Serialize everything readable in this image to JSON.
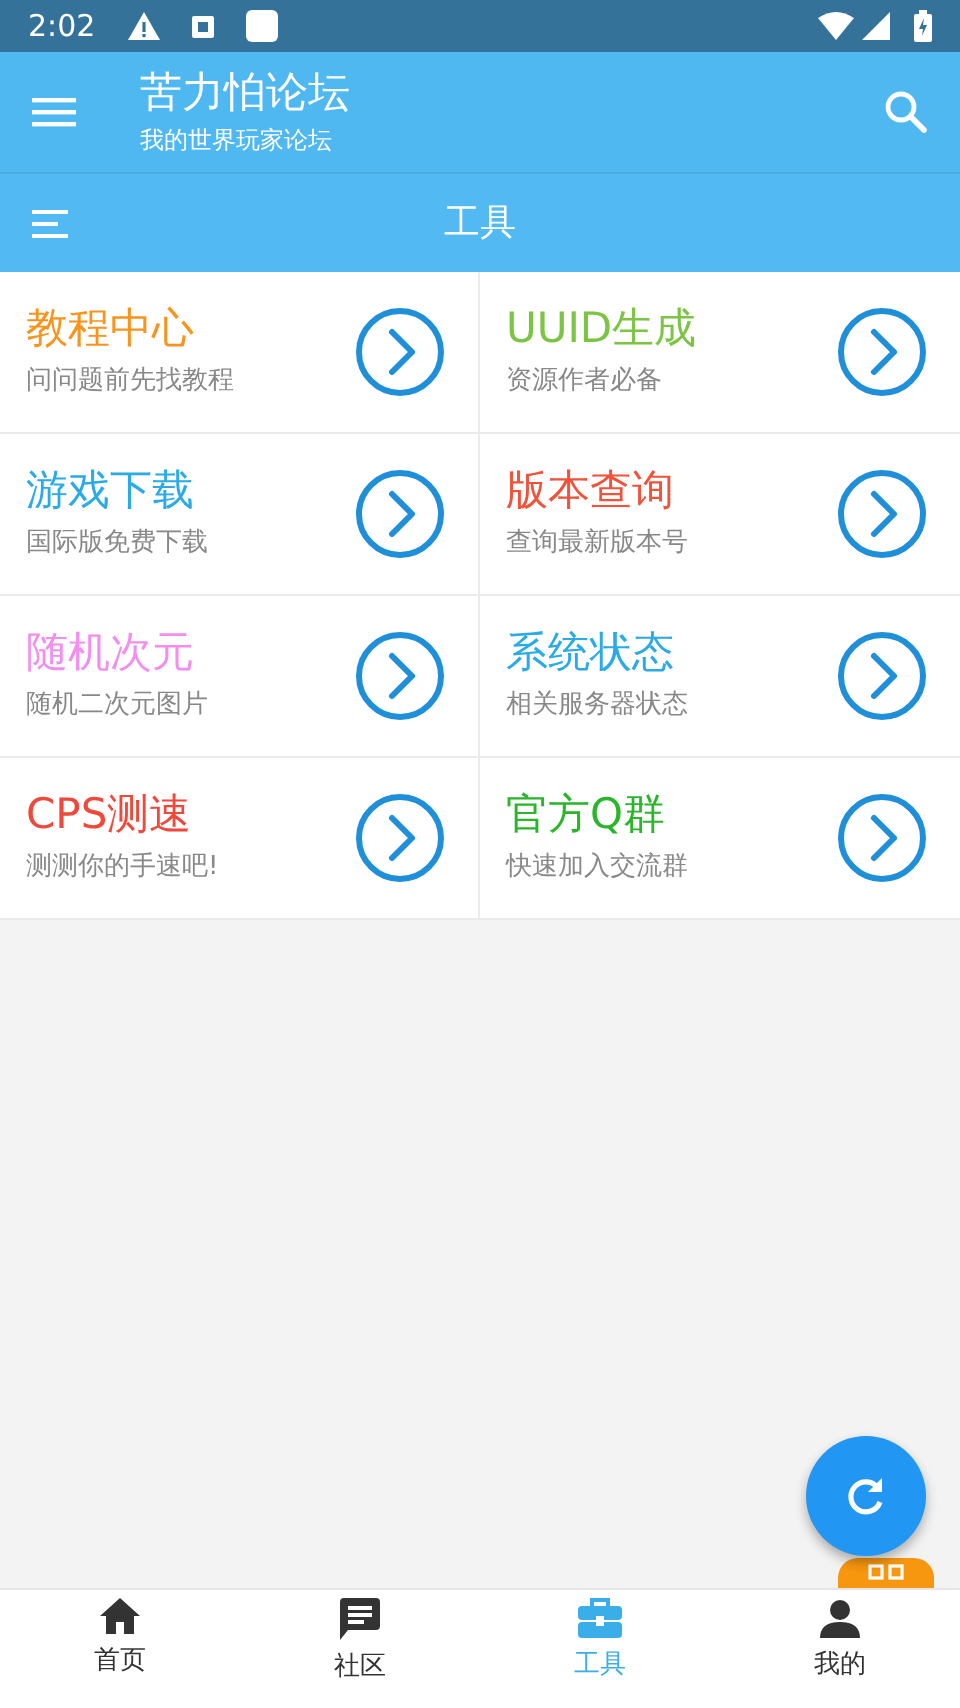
{
  "status_bar": {
    "time": "2:02"
  },
  "app_bar": {
    "title": "苦力怕论坛",
    "subtitle": "我的世界玩家论坛"
  },
  "section_bar": {
    "title": "工具"
  },
  "tools": [
    {
      "title": "教程中心",
      "subtitle": "问问题前先找教程",
      "color": "#f7941d"
    },
    {
      "title": "UUID生成",
      "subtitle": "资源作者必备",
      "color": "#7cc443"
    },
    {
      "title": "游戏下载",
      "subtitle": "国际版免费下载",
      "color": "#2aaae6"
    },
    {
      "title": "版本查询",
      "subtitle": "查询最新版本号",
      "color": "#f0533a"
    },
    {
      "title": "随机次元",
      "subtitle": "随机二次元图片",
      "color": "#f28ef0"
    },
    {
      "title": "系统状态",
      "subtitle": "相关服务器状态",
      "color": "#2aaae6"
    },
    {
      "title": "CPS测速",
      "subtitle": "测测你的手速吧!",
      "color": "#f0483a"
    },
    {
      "title": "官方Q群",
      "subtitle": "快速加入交流群",
      "color": "#2ab52a"
    }
  ],
  "bottom_nav": [
    {
      "label": "首页",
      "kind": "home",
      "selected": false
    },
    {
      "label": "社区",
      "kind": "chat",
      "selected": false
    },
    {
      "label": "工具",
      "kind": "toolbox",
      "selected": true
    },
    {
      "label": "我的",
      "kind": "person",
      "selected": false
    }
  ]
}
